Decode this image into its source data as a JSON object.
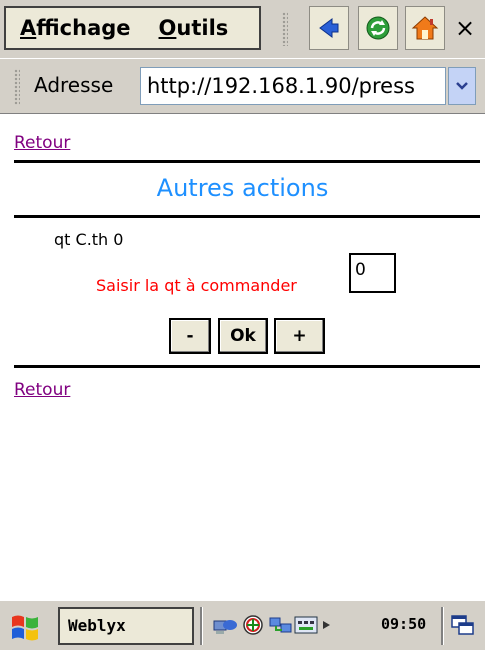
{
  "menu": {
    "affichage": "Affichage",
    "outils": "Outils",
    "close": "×"
  },
  "address": {
    "label": "Adresse",
    "url": "http://192.168.1.90/press"
  },
  "page": {
    "back_link_top": "Retour",
    "back_link_bottom": "Retour",
    "section_title": "Autres actions",
    "qt_label": "qt C.th 0",
    "prompt": "Saisir la qt à commander",
    "qty_value": "0",
    "minus_label": "-",
    "ok_label": "Ok",
    "plus_label": "+"
  },
  "taskbar": {
    "app": "Weblyx",
    "time": "09:50"
  },
  "colors": {
    "section_title": "#1e90ff",
    "prompt": "#ff0000",
    "link": "#800080"
  }
}
